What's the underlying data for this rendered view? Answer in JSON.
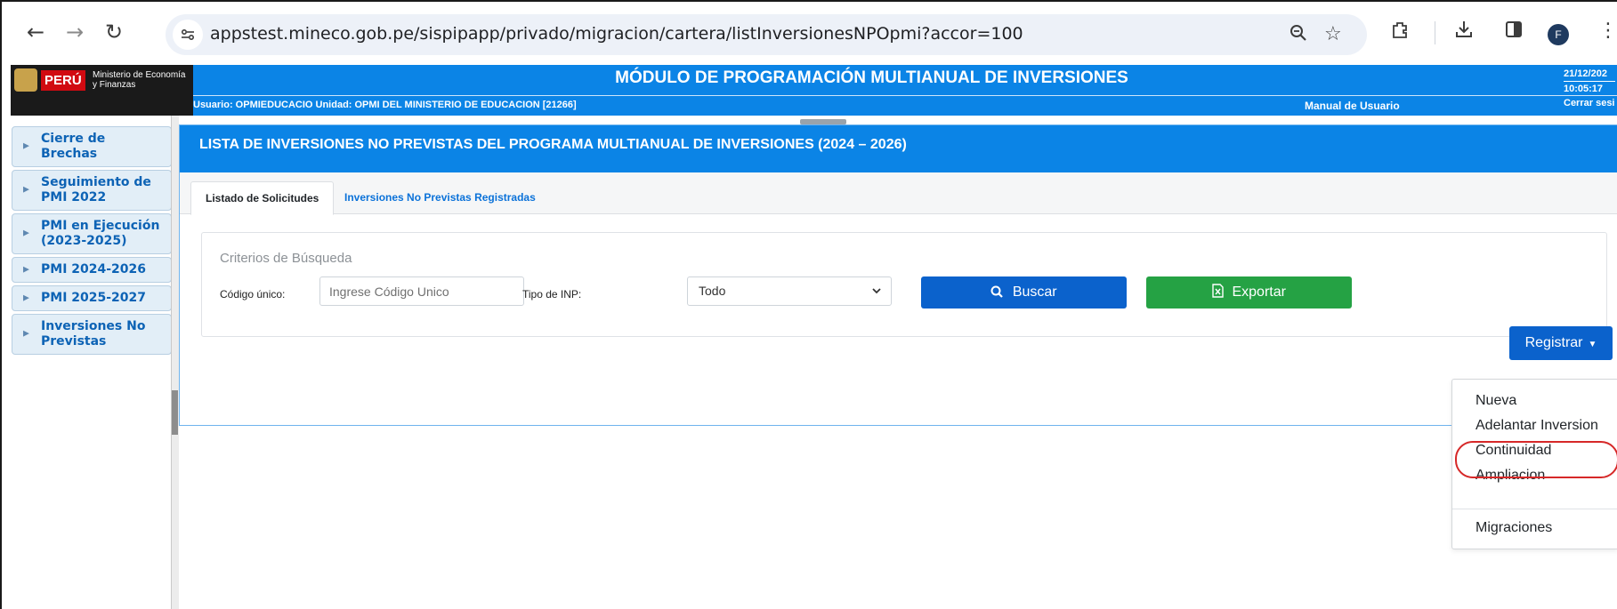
{
  "browser": {
    "url": "appstest.mineco.gob.pe/sispipapp/privado/migracion/cartera/listInversionesNPOpmi?accor=100",
    "profile_initial": "F"
  },
  "header": {
    "logo_peru": "PERÚ",
    "logo_ministry": "Ministerio de Economía y Finanzas",
    "title": "MÓDULO DE PROGRAMACIÓN MULTIANUAL DE INVERSIONES",
    "user_info": "Usuario: OPMIEDUCACIO    Unidad: OPMI DEL MINISTERIO DE EDUCACION  [21266]",
    "manual_link": "Manual de Usuario",
    "date": "21/12/202",
    "time": "10:05:17",
    "logout": "Cerrar sesi"
  },
  "sidebar": {
    "items": [
      {
        "label": "Cierre de Brechas"
      },
      {
        "label": "Seguimiento de PMI 2022"
      },
      {
        "label": "PMI en Ejecución (2023-2025)"
      },
      {
        "label": "PMI 2024-2026"
      },
      {
        "label": "PMI 2025-2027"
      },
      {
        "label": "Inversiones No Previstas"
      }
    ]
  },
  "panel": {
    "title": "LISTA DE INVERSIONES NO PREVISTAS DEL PROGRAMA MULTIANUAL DE INVERSIONES (2024 – 2026)",
    "tabs": [
      {
        "label": "Listado de Solicitudes"
      },
      {
        "label": "Inversiones No Previstas Registradas"
      }
    ],
    "criteria_title": "Criterios de Búsqueda",
    "codigo_label": "Código único:",
    "codigo_placeholder": "Ingrese Código Unico",
    "tipo_label": "Tipo de INP:",
    "tipo_value": "Todo",
    "search_button": "Buscar",
    "export_button": "Exportar",
    "register_button": "Registrar"
  },
  "dropdown": {
    "items": [
      {
        "label": "Nueva"
      },
      {
        "label": "Adelantar Inversion"
      },
      {
        "label": "Continuidad"
      },
      {
        "label": "Ampliacion"
      },
      {
        "label": "Migraciones"
      }
    ]
  },
  "colors": {
    "brand_blue": "#0b84e6",
    "button_blue": "#0b62cc",
    "button_green": "#25a244",
    "highlight_red": "#d62828"
  }
}
